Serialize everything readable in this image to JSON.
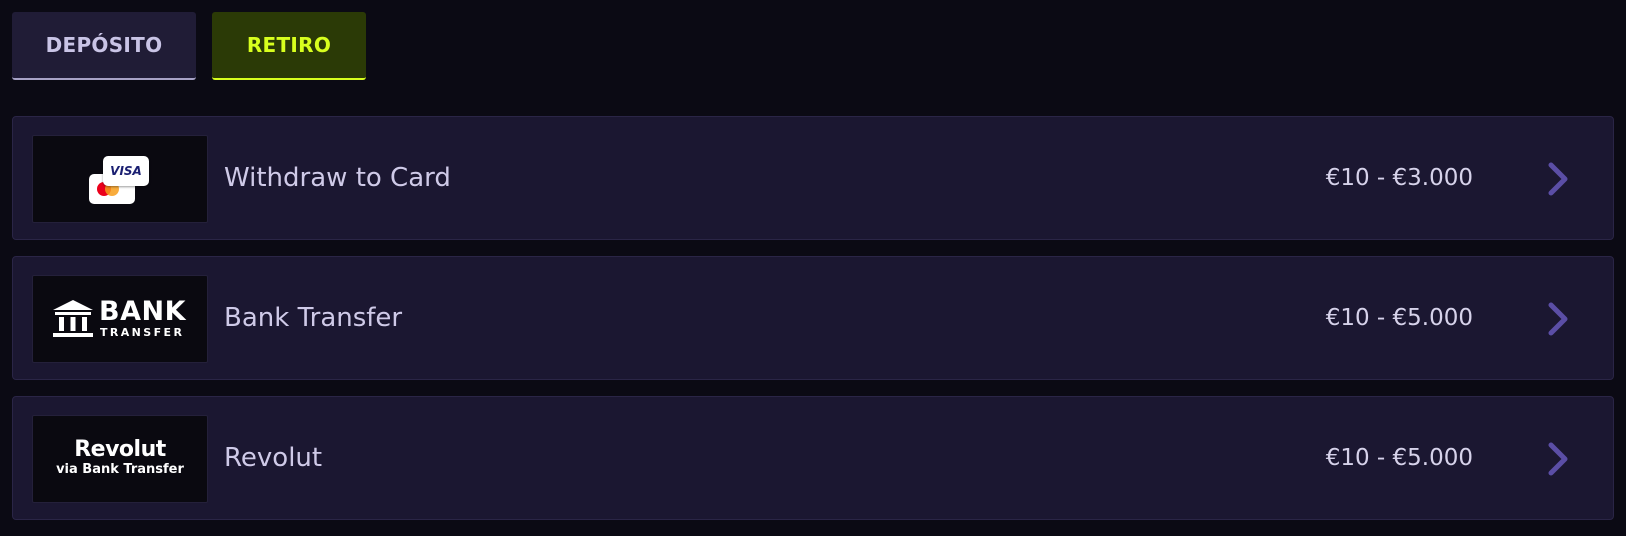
{
  "tabs": [
    {
      "label": "DEPÓSITO",
      "active": false
    },
    {
      "label": "RETIRO",
      "active": true
    }
  ],
  "methods": [
    {
      "name": "Withdraw to Card",
      "limits": "€10 - €3.000",
      "logo": {
        "type": "card-logos",
        "card_text": "VISA"
      }
    },
    {
      "name": "Bank Transfer",
      "limits": "€10 - €5.000",
      "logo": {
        "type": "bank-transfer-logo",
        "title": "BANK",
        "subtitle": "TRANSFER"
      }
    },
    {
      "name": "Revolut",
      "limits": "€10 - €5.000",
      "logo": {
        "type": "revolut-logo",
        "title": "Revolut",
        "subtitle": "via Bank Transfer"
      }
    }
  ],
  "colors": {
    "background": "#0b0a14",
    "row_background": "#1b1731",
    "accent": "#d8ff1e",
    "chevron": "#5b4ea6"
  }
}
